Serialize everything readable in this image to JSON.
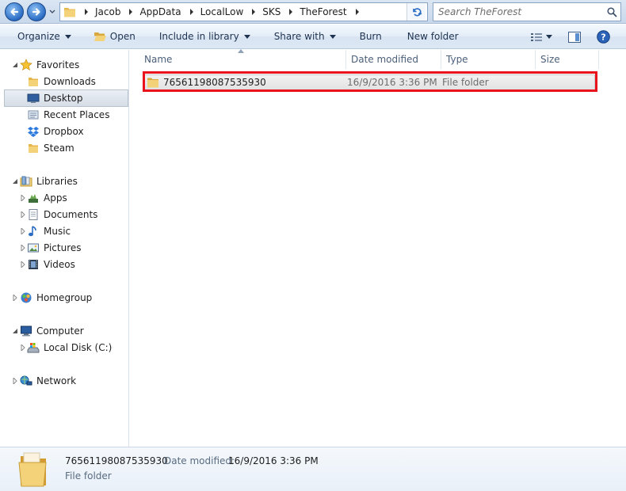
{
  "window": {
    "breadcrumbs": [
      "Jacob",
      "AppData",
      "LocalLow",
      "SKS",
      "TheForest"
    ],
    "search_placeholder": "Search TheForest"
  },
  "toolbar": {
    "organize": "Organize",
    "open": "Open",
    "include_in_library": "Include in library",
    "share_with": "Share with",
    "burn": "Burn",
    "new_folder": "New folder"
  },
  "nav": {
    "favorites": "Favorites",
    "downloads": "Downloads",
    "desktop": "Desktop",
    "recent_places": "Recent Places",
    "dropbox": "Dropbox",
    "steam": "Steam",
    "libraries": "Libraries",
    "apps": "Apps",
    "documents": "Documents",
    "music": "Music",
    "pictures": "Pictures",
    "videos": "Videos",
    "homegroup": "Homegroup",
    "computer": "Computer",
    "local_disk": "Local Disk (C:)",
    "network": "Network"
  },
  "columns": {
    "name": "Name",
    "date_modified": "Date modified",
    "type": "Type",
    "size": "Size"
  },
  "files": [
    {
      "name": "76561198087535930",
      "date_modified": "16/9/2016 3:36 PM",
      "type": "File folder",
      "size": ""
    }
  ],
  "details": {
    "name": "76561198087535930",
    "date_label": "Date modified:",
    "date_value": "16/9/2016 3:36 PM",
    "type": "File folder"
  },
  "colors": {
    "highlight": "#e8131b",
    "folder": "#f0c96a",
    "accent_blue": "#2a6cc4"
  },
  "icons": {
    "back": "back-arrow-icon",
    "forward": "forward-arrow-icon",
    "refresh": "refresh-icon",
    "search": "search-icon",
    "views": "views-icon",
    "preview_pane": "preview-pane-icon",
    "help": "help-icon"
  }
}
